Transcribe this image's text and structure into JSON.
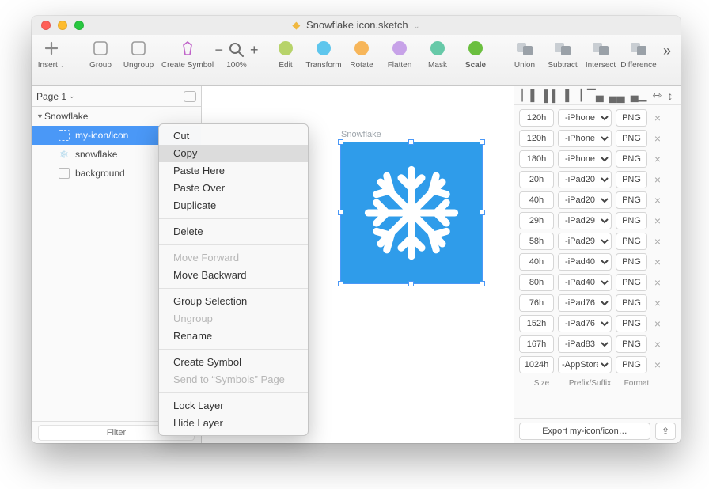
{
  "window": {
    "title": "Snowflake icon.sketch"
  },
  "toolbar": {
    "items": [
      {
        "label": "Insert"
      },
      {
        "label": "Group"
      },
      {
        "label": "Ungroup"
      },
      {
        "label": "Create Symbol"
      },
      {
        "label": "Edit",
        "color": "#b7d36a"
      },
      {
        "label": "Transform",
        "color": "#5ec6ed"
      },
      {
        "label": "Rotate",
        "color": "#f7b65a"
      },
      {
        "label": "Flatten",
        "color": "#c7a2e8"
      },
      {
        "label": "Mask",
        "color": "#67c9a8"
      },
      {
        "label": "Scale",
        "color": "#6bbf3f",
        "bold": true
      },
      {
        "label": "Union",
        "color": "#9aa1a8"
      },
      {
        "label": "Subtract",
        "color": "#9aa1a8"
      },
      {
        "label": "Intersect",
        "color": "#9aa1a8"
      },
      {
        "label": "Difference",
        "color": "#9aa1a8"
      }
    ],
    "zoom_minus": "−",
    "zoom_plus": "+",
    "zoom_pct": "100%"
  },
  "sidebar": {
    "page_label": "Page 1",
    "artboard": "Snowflake",
    "layers": [
      {
        "name": "my-icon/icon",
        "selected": true,
        "kind": "dashed"
      },
      {
        "name": "snowflake",
        "kind": "flake"
      },
      {
        "name": "background",
        "kind": "rect"
      }
    ],
    "filter_placeholder": "Filter"
  },
  "canvas": {
    "artboard_label": "Snowflake"
  },
  "context_menu": {
    "items": [
      {
        "label": "Cut"
      },
      {
        "label": "Copy",
        "highlight": true
      },
      {
        "label": "Paste Here"
      },
      {
        "label": "Paste Over"
      },
      {
        "label": "Duplicate"
      },
      {
        "divider": true
      },
      {
        "label": "Delete"
      },
      {
        "divider": true
      },
      {
        "label": "Move Forward",
        "disabled": true
      },
      {
        "label": "Move Backward"
      },
      {
        "divider": true
      },
      {
        "label": "Group Selection"
      },
      {
        "label": "Ungroup",
        "disabled": true
      },
      {
        "label": "Rename"
      },
      {
        "divider": true
      },
      {
        "label": "Create Symbol"
      },
      {
        "label": "Send to “Symbols” Page",
        "disabled": true
      },
      {
        "divider": true
      },
      {
        "label": "Lock Layer"
      },
      {
        "label": "Hide Layer"
      }
    ]
  },
  "inspector": {
    "exports": [
      {
        "size": "120h",
        "prefix": "-iPhone",
        "format": "PNG"
      },
      {
        "size": "120h",
        "prefix": "-iPhone",
        "format": "PNG"
      },
      {
        "size": "180h",
        "prefix": "-iPhone",
        "format": "PNG"
      },
      {
        "size": "20h",
        "prefix": "-iPad20",
        "format": "PNG"
      },
      {
        "size": "40h",
        "prefix": "-iPad20",
        "format": "PNG"
      },
      {
        "size": "29h",
        "prefix": "-iPad29",
        "format": "PNG"
      },
      {
        "size": "58h",
        "prefix": "-iPad29",
        "format": "PNG"
      },
      {
        "size": "40h",
        "prefix": "-iPad40",
        "format": "PNG"
      },
      {
        "size": "80h",
        "prefix": "-iPad40",
        "format": "PNG"
      },
      {
        "size": "76h",
        "prefix": "-iPad76",
        "format": "PNG"
      },
      {
        "size": "152h",
        "prefix": "-iPad76",
        "format": "PNG"
      },
      {
        "size": "167h",
        "prefix": "-iPad83",
        "format": "PNG"
      },
      {
        "size": "1024h",
        "prefix": "-AppStore",
        "format": "PNG"
      }
    ],
    "headers": {
      "size": "Size",
      "prefix": "Prefix/Suffix",
      "format": "Format"
    },
    "export_button": "Export my-icon/icon…"
  }
}
